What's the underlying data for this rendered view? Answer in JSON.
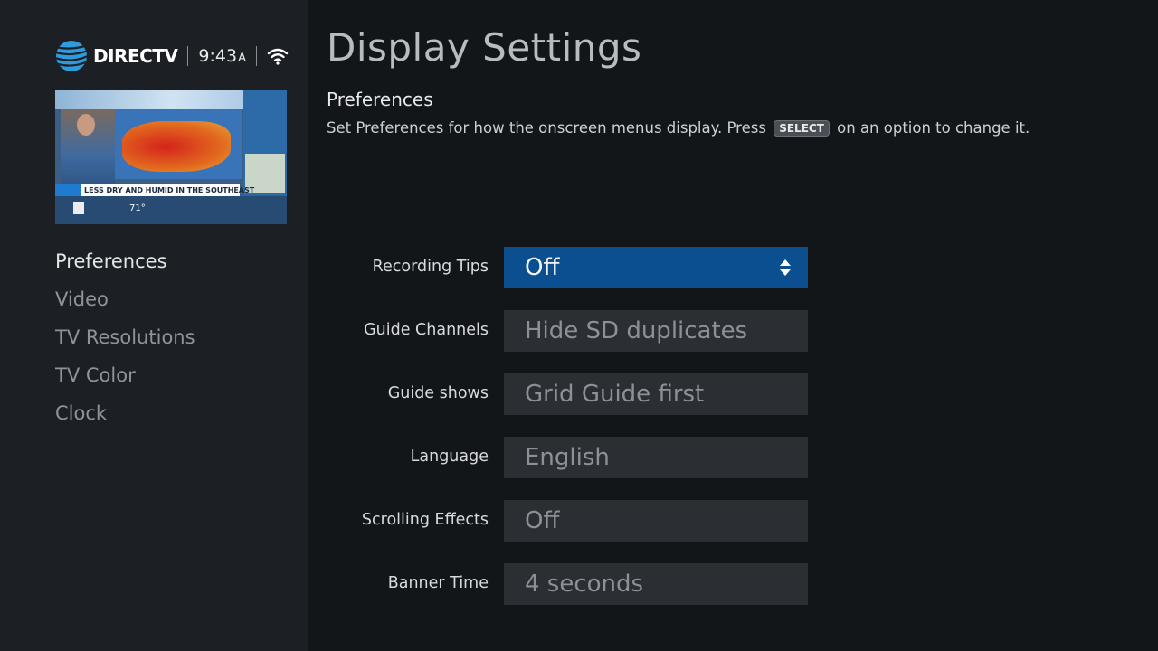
{
  "header": {
    "brand": "DIRECTV",
    "time": "9:43",
    "ampm": "A"
  },
  "preview": {
    "headline": "LESS DRY AND HUMID IN THE SOUTHEAST",
    "temperature": "71°"
  },
  "sidebar": {
    "items": [
      {
        "label": "Preferences",
        "active": true
      },
      {
        "label": "Video",
        "active": false
      },
      {
        "label": "TV Resolutions",
        "active": false
      },
      {
        "label": "TV Color",
        "active": false
      },
      {
        "label": "Clock",
        "active": false
      }
    ]
  },
  "main": {
    "title": "Display Settings",
    "section": "Preferences",
    "description_before": "Set Preferences for how the onscreen menus display. Press",
    "description_key": "SELECT",
    "description_after": "on an option to change it."
  },
  "settings": [
    {
      "label": "Recording Tips",
      "value": "Off",
      "selected": true
    },
    {
      "label": "Guide Channels",
      "value": "Hide SD duplicates",
      "selected": false
    },
    {
      "label": "Guide shows",
      "value": "Grid Guide first",
      "selected": false
    },
    {
      "label": "Language",
      "value": "English",
      "selected": false
    },
    {
      "label": "Scrolling Effects",
      "value": "Off",
      "selected": false
    },
    {
      "label": "Banner Time",
      "value": "4 seconds",
      "selected": false
    }
  ],
  "colors": {
    "selected_field": "#0b4f91",
    "field": "#2b2f33",
    "sidebar": "#1c1f23",
    "background": "#131619"
  }
}
